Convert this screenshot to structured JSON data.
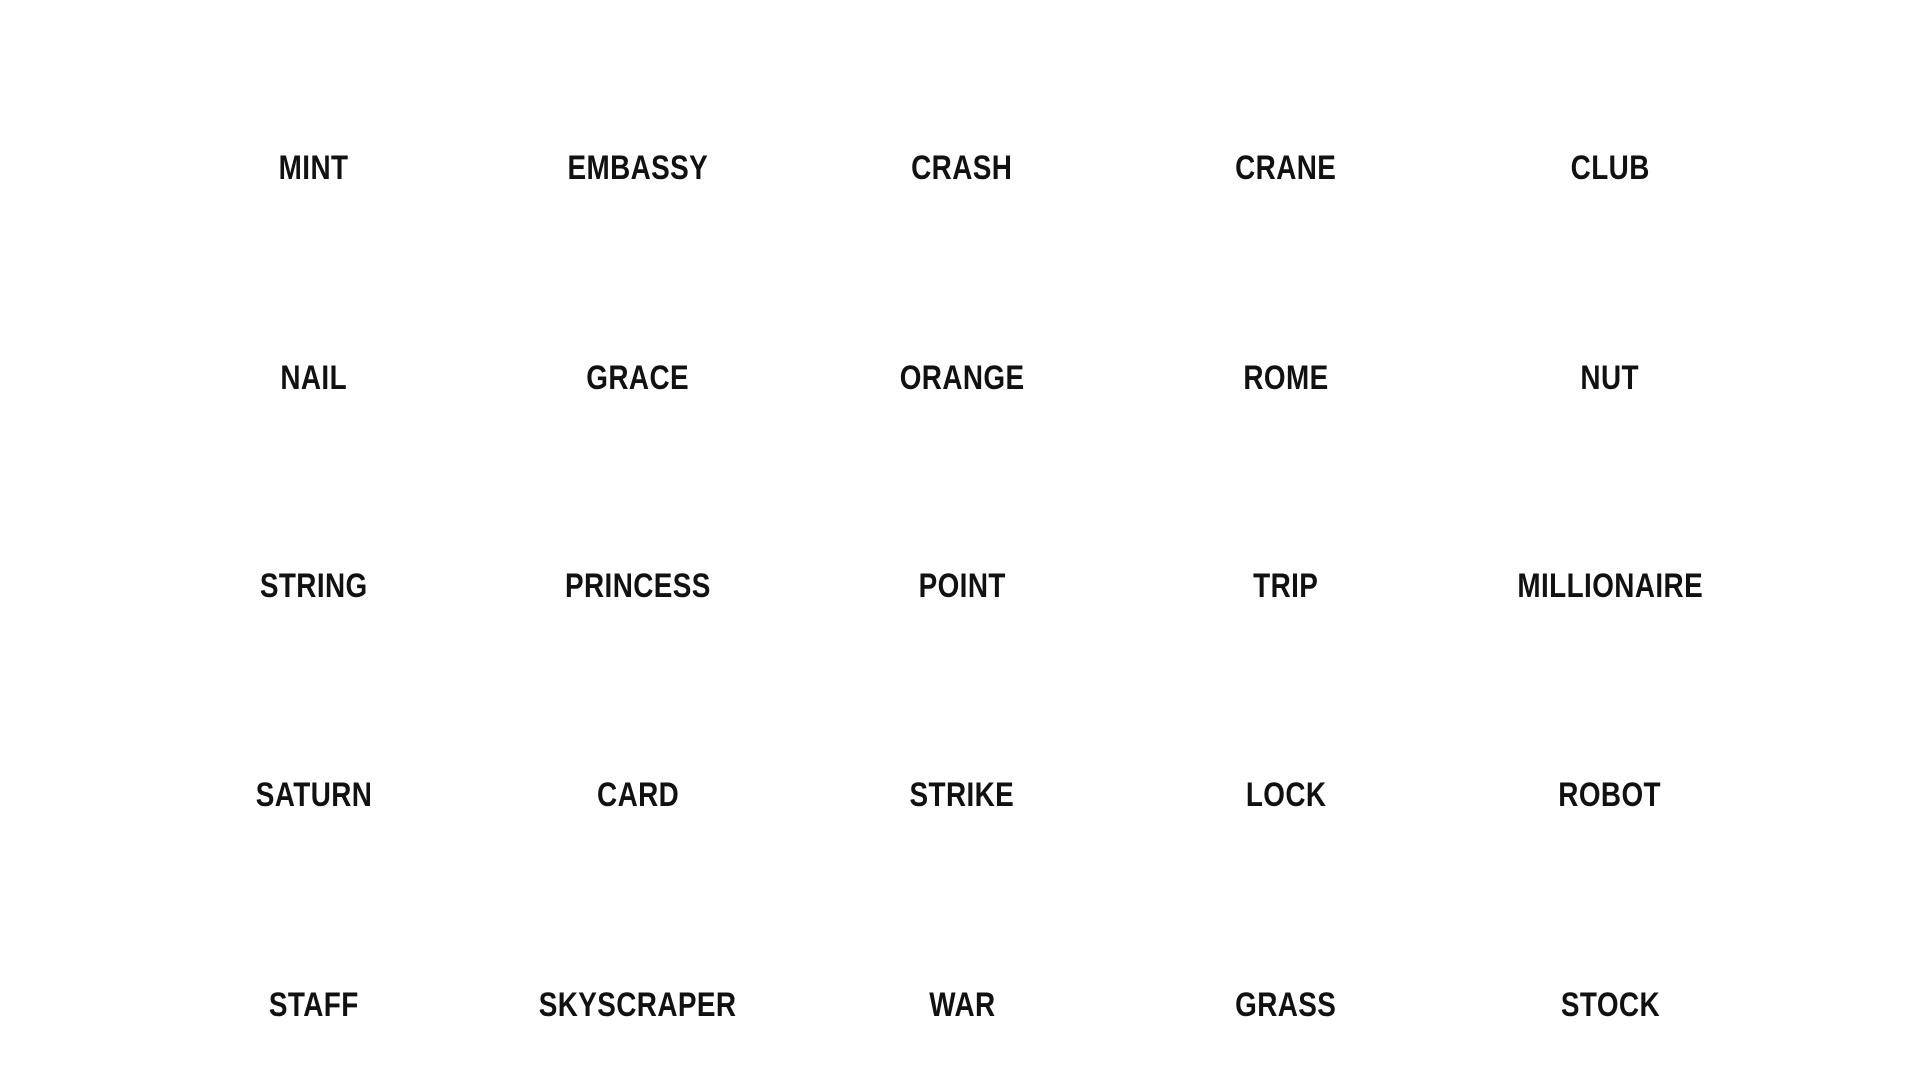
{
  "board": {
    "words": [
      [
        "MINT",
        "EMBASSY",
        "CRASH",
        "CRANE",
        "CLUB"
      ],
      [
        "NAIL",
        "GRACE",
        "ORANGE",
        "ROME",
        "NUT"
      ],
      [
        "STRING",
        "PRINCESS",
        "POINT",
        "TRIP",
        "MILLIONAIRE"
      ],
      [
        "SATURN",
        "CARD",
        "STRIKE",
        "LOCK",
        "ROBOT"
      ],
      [
        "STAFF",
        "SKYSCRAPER",
        "WAR",
        "GRASS",
        "STOCK"
      ]
    ]
  }
}
